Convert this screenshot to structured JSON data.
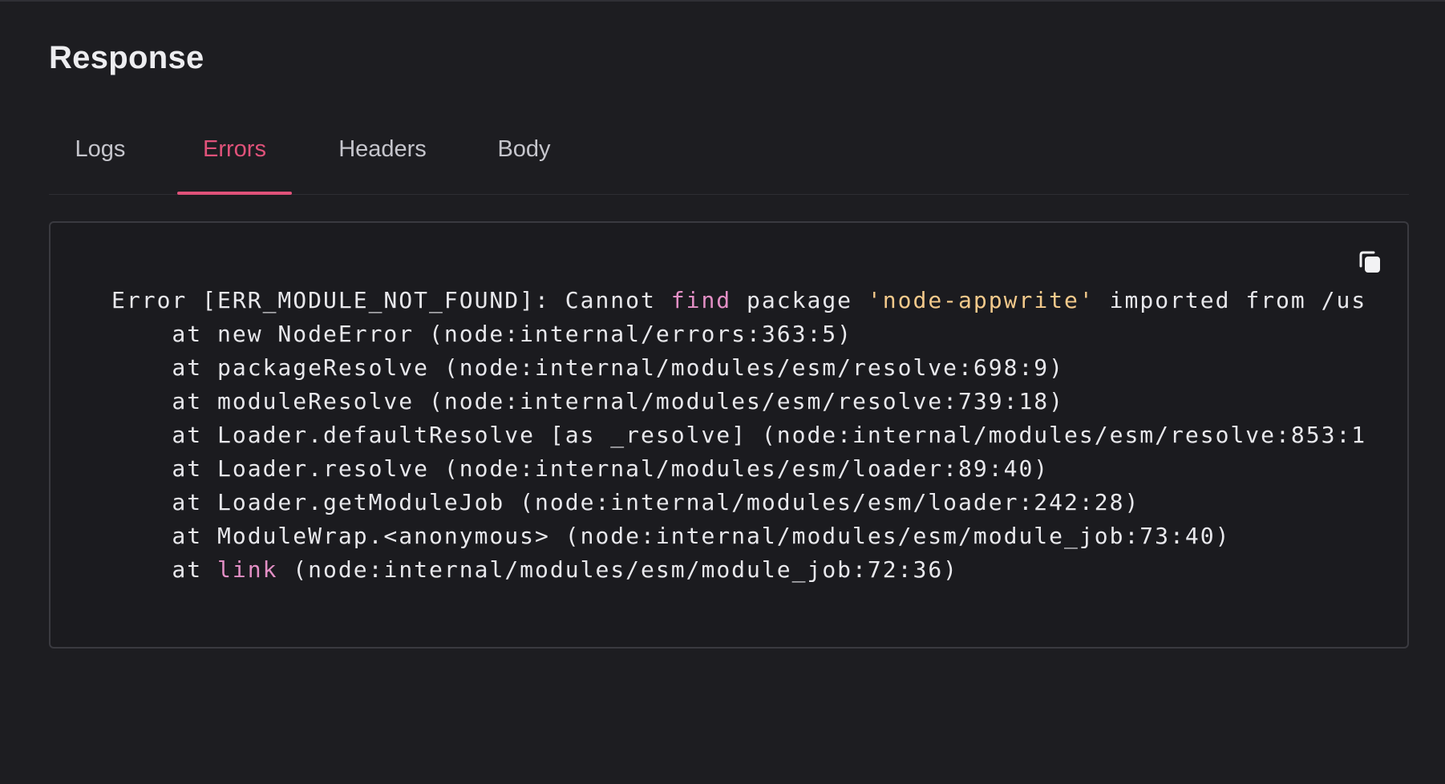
{
  "response": {
    "title": "Response",
    "tabs": [
      {
        "label": "Logs",
        "active": false
      },
      {
        "label": "Errors",
        "active": true
      },
      {
        "label": "Headers",
        "active": false
      },
      {
        "label": "Body",
        "active": false
      }
    ],
    "copy_icon": "copy-icon",
    "error_output": {
      "line1": {
        "seg1": "Error [ERR_MODULE_NOT_FOUND]: Cannot ",
        "kw": "find",
        "seg2": " package ",
        "str": "'node-appwrite'",
        "seg3": " imported from /us"
      },
      "line2": "    at new NodeError (node:internal/errors:363:5)",
      "line3": "    at packageResolve (node:internal/modules/esm/resolve:698:9)",
      "line4": "    at moduleResolve (node:internal/modules/esm/resolve:739:18)",
      "line5": "    at Loader.defaultResolve [as _resolve] (node:internal/modules/esm/resolve:853:1",
      "line6": "    at Loader.resolve (node:internal/modules/esm/loader:89:40)",
      "line7": "    at Loader.getModuleJob (node:internal/modules/esm/loader:242:28)",
      "line8": "    at ModuleWrap.<anonymous> (node:internal/modules/esm/module_job:73:40)",
      "line9": {
        "seg1": "    at ",
        "kw": "link",
        "seg2": " (node:internal/modules/esm/module_job:72:36)"
      }
    }
  },
  "colors": {
    "background": "#1d1d21",
    "accent": "#e0527a",
    "keyword": "#e38fc5",
    "string": "#f3c98b"
  }
}
